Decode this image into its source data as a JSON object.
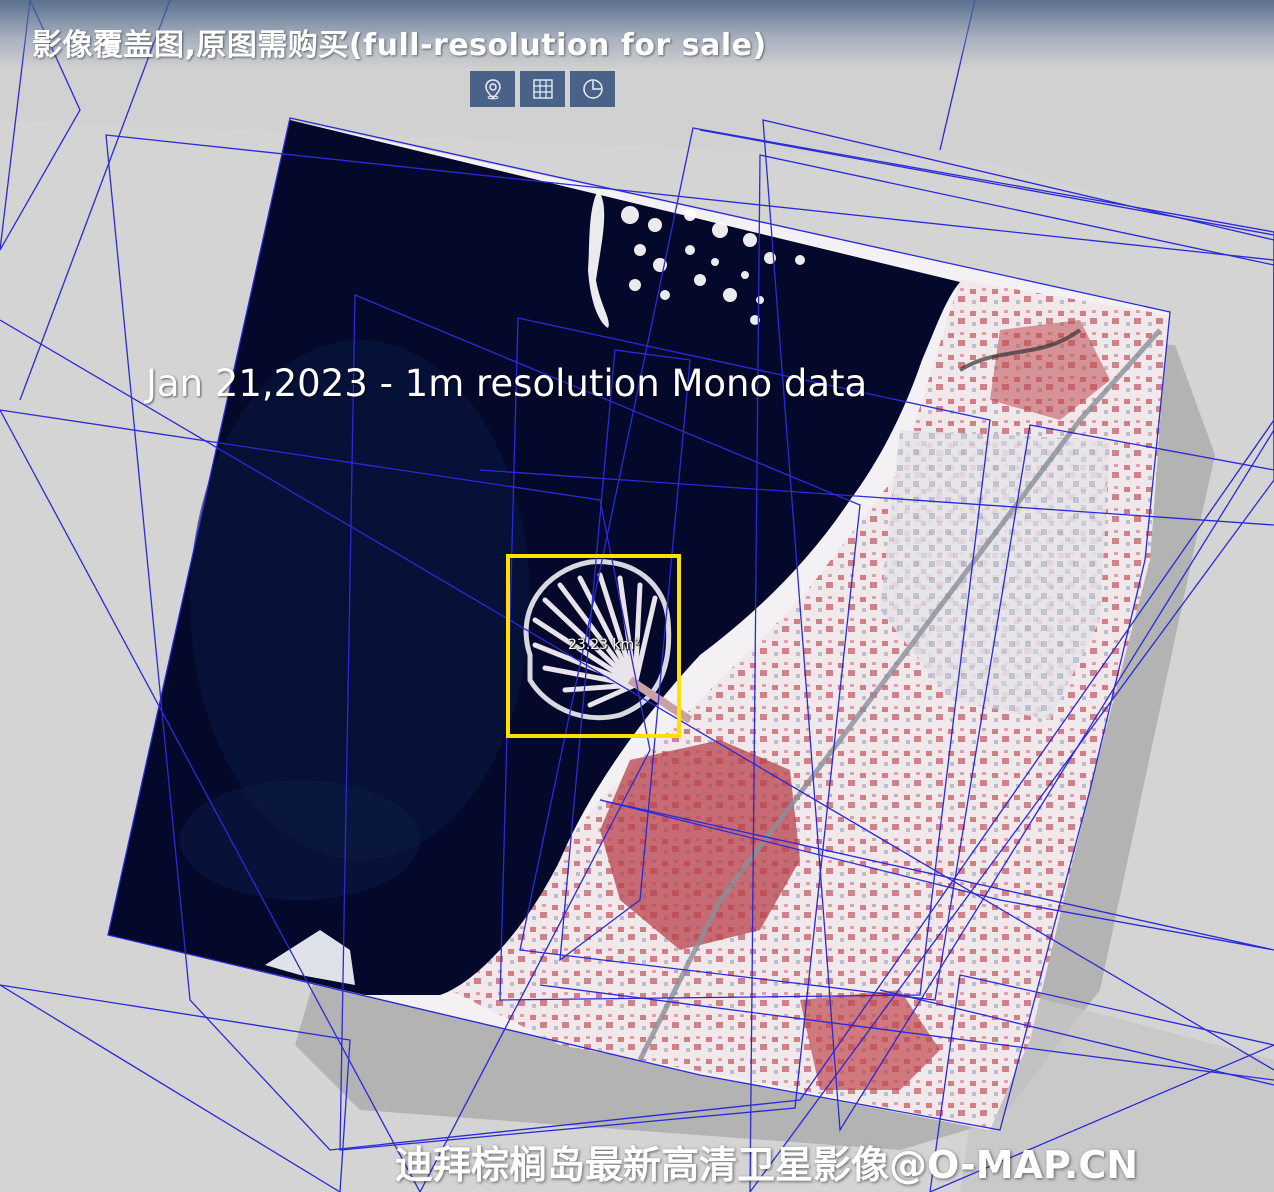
{
  "header": {
    "title": "影像覆盖图,原图需购买(full-resolution for sale)"
  },
  "toolbar": {
    "buttons": [
      {
        "icon": "location-pin-icon"
      },
      {
        "icon": "grid-icon"
      },
      {
        "icon": "pie-clock-icon"
      }
    ]
  },
  "map": {
    "caption": "Jan 21,2023 - 1m resolution Mono data",
    "selection_area_label": "23.23 km²",
    "watermark": "迪拜棕榈岛最新高清卫星影像@O-MAP.CN"
  },
  "colors": {
    "footprint_outline": "#2a2ad8",
    "selection_box": "#ffe000",
    "toolbar_button": "#4a6288",
    "water": "#050a2a",
    "land": "#f2f0f2",
    "urban_red": "#c0454c"
  }
}
